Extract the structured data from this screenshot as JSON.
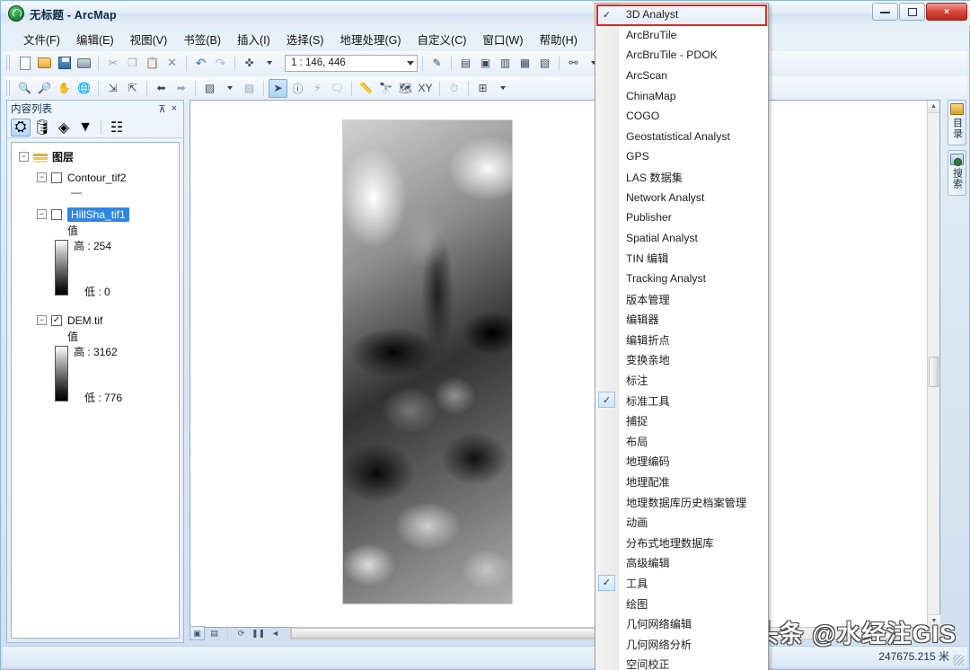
{
  "window": {
    "title": "无标题 - ArcMap",
    "app_icon": "arcmap-globe-icon",
    "minimize": "minimize-button",
    "maximize": "maximize-button",
    "close": "×"
  },
  "menubar": {
    "items": [
      {
        "label": "文件(F)"
      },
      {
        "label": "编辑(E)"
      },
      {
        "label": "视图(V)"
      },
      {
        "label": "书签(B)"
      },
      {
        "label": "插入(I)"
      },
      {
        "label": "选择(S)"
      },
      {
        "label": "地理处理(G)"
      },
      {
        "label": "自定义(C)"
      },
      {
        "label": "窗口(W)"
      },
      {
        "label": "帮助(H)"
      }
    ]
  },
  "toolbar_standard": {
    "scale_value": "1 : 146, 446",
    "buttons": [
      {
        "name": "new-map-button"
      },
      {
        "name": "open-button"
      },
      {
        "name": "save-button"
      },
      {
        "name": "print-button"
      },
      {
        "name": "cut-button"
      },
      {
        "name": "copy-button"
      },
      {
        "name": "paste-button"
      },
      {
        "name": "delete-button"
      },
      {
        "name": "undo-button"
      },
      {
        "name": "redo-button"
      },
      {
        "name": "add-data-button"
      }
    ]
  },
  "toolbar_tools": {
    "buttons": [
      {
        "name": "zoom-in-button"
      },
      {
        "name": "zoom-out-button"
      },
      {
        "name": "pan-button"
      },
      {
        "name": "full-extent-button"
      },
      {
        "name": "fixed-zoom-in-button"
      },
      {
        "name": "fixed-zoom-out-button"
      },
      {
        "name": "previous-extent-button"
      },
      {
        "name": "next-extent-button"
      },
      {
        "name": "select-features-button"
      },
      {
        "name": "clear-selection-button"
      },
      {
        "name": "select-elements-button"
      },
      {
        "name": "identify-button"
      },
      {
        "name": "hyperlink-button"
      },
      {
        "name": "html-popup-button"
      },
      {
        "name": "measure-button"
      },
      {
        "name": "find-button"
      },
      {
        "name": "find-route-button"
      },
      {
        "name": "go-to-xy-button"
      },
      {
        "name": "time-slider-button"
      },
      {
        "name": "create-viewer-window-button"
      }
    ]
  },
  "toc": {
    "title": "内容列表",
    "pin_icon": "pin-icon",
    "close_icon": "×",
    "tool_buttons": [
      {
        "name": "list-by-drawing-order"
      },
      {
        "name": "list-by-source"
      },
      {
        "name": "list-by-visibility"
      },
      {
        "name": "list-by-selection"
      },
      {
        "name": "options-button"
      }
    ],
    "root": {
      "label": "图层",
      "expander": "−"
    },
    "layers": [
      {
        "name": "Contour_tif2",
        "checked": false,
        "expander": "−",
        "symbol": "—",
        "selected": false
      },
      {
        "name": "HillSha_tif1",
        "checked": false,
        "expander": "−",
        "selected": true,
        "legend": {
          "title": "值",
          "high": "高 : 254",
          "low": "低 : 0"
        }
      },
      {
        "name": "DEM.tif",
        "checked": true,
        "expander": "−",
        "selected": false,
        "legend": {
          "title": "值",
          "high": "高 : 3162",
          "low": "低 : 776"
        }
      }
    ]
  },
  "map": {
    "bottom_buttons": [
      {
        "name": "data-view-button"
      },
      {
        "name": "layout-view-button"
      },
      {
        "name": "refresh-button"
      },
      {
        "name": "pause-drawing-button"
      },
      {
        "name": "scrollbar-left-arrow"
      }
    ],
    "scroll_up": "▲",
    "scroll_down": "▼"
  },
  "dock_right": {
    "tabs": [
      {
        "label": "目录",
        "icon": "catalog-icon"
      },
      {
        "label": "搜索",
        "icon": "search-icon"
      }
    ]
  },
  "status": {
    "coordinates": "247675.215 米"
  },
  "watermark": {
    "text": "头条 @水经注GIS"
  },
  "dropdown": {
    "name": "toolbars-context-menu",
    "highlight_color": "#e8231f",
    "items": [
      {
        "label": "3D Analyst",
        "checked": true,
        "highlighted": true
      },
      {
        "label": "ArcBruTile",
        "checked": false
      },
      {
        "label": "ArcBruTile - PDOK",
        "checked": false
      },
      {
        "label": "ArcScan",
        "checked": false
      },
      {
        "label": "ChinaMap",
        "checked": false
      },
      {
        "label": "COGO",
        "checked": false
      },
      {
        "label": "Geostatistical Analyst",
        "checked": false
      },
      {
        "label": "GPS",
        "checked": false
      },
      {
        "label": "LAS 数据集",
        "checked": false
      },
      {
        "label": "Network Analyst",
        "checked": false
      },
      {
        "label": "Publisher",
        "checked": false
      },
      {
        "label": "Spatial Analyst",
        "checked": false
      },
      {
        "label": "TIN 编辑",
        "checked": false
      },
      {
        "label": "Tracking Analyst",
        "checked": false
      },
      {
        "label": "版本管理",
        "checked": false
      },
      {
        "label": "编辑器",
        "checked": false
      },
      {
        "label": "编辑折点",
        "checked": false
      },
      {
        "label": "变换亲地",
        "checked": false
      },
      {
        "label": "标注",
        "checked": false
      },
      {
        "label": "标准工具",
        "checked": true
      },
      {
        "label": "捕捉",
        "checked": false
      },
      {
        "label": "布局",
        "checked": false
      },
      {
        "label": "地理编码",
        "checked": false
      },
      {
        "label": "地理配准",
        "checked": false
      },
      {
        "label": "地理数据库历史档案管理",
        "checked": false
      },
      {
        "label": "动画",
        "checked": false
      },
      {
        "label": "分布式地理数据库",
        "checked": false
      },
      {
        "label": "高级编辑",
        "checked": false
      },
      {
        "label": "工具",
        "checked": true
      },
      {
        "label": "绘图",
        "checked": false
      },
      {
        "label": "几何网络编辑",
        "checked": false
      },
      {
        "label": "几何网络分析",
        "checked": false
      },
      {
        "label": "空间校正",
        "checked": false
      }
    ]
  }
}
